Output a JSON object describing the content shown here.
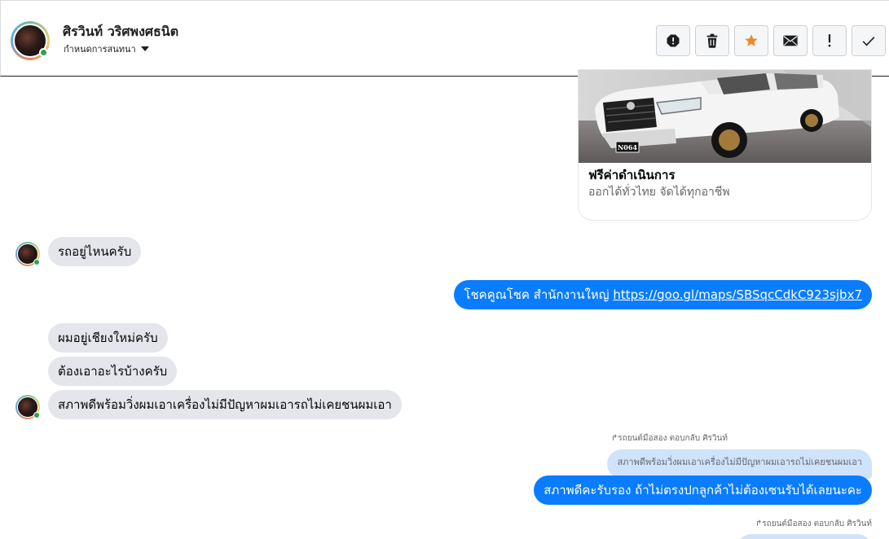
{
  "header": {
    "contact_name": "ศิรวินท์ วริศพงศธนิต",
    "assign_label": "กำหนดการสนทนา",
    "actions": [
      {
        "name": "spam-button",
        "icon": "exclamation-circle-icon"
      },
      {
        "name": "delete-button",
        "icon": "trash-icon"
      },
      {
        "name": "star-button",
        "icon": "star-icon",
        "color": "#f0892b"
      },
      {
        "name": "mark-unread-button",
        "icon": "envelope-icon"
      },
      {
        "name": "important-button",
        "icon": "exclamation-icon"
      },
      {
        "name": "mark-done-button",
        "icon": "checkmark-icon"
      }
    ]
  },
  "card": {
    "plate": "N064",
    "title": "ฟรีค่าดำเนินการ",
    "subtitle": "ออกได้ทั่วไทย จัดได้ทุกอาชีพ"
  },
  "messages": {
    "m1": "รถอยู่ไหนครับ",
    "m2_text": "โชคคูณโชค สำนักงานใหญ่ ",
    "m2_link": "https://goo.gl/maps/SBSqcCdkC923sjbx7",
    "m3": "ผมอยู่เชียงใหม่ครับ",
    "m4": "ต้องเอาอะไรบ้างครับ",
    "m5": "สภาพดีพร้อมวิ่งผมเอาเครื่องไม่มีปัญหาผมเอารถไม่เคยชนผมเอา",
    "reply1_meta": "รถยนต์มือสอง ตอบกลับ ศิรวินท์",
    "reply1_quote": "สภาพดีพร้อมวิ่งผมเอาเครื่องไม่มีปัญหาผมเอารถไม่เคยชนผมเอา",
    "m6": "สภาพดีคะรับรอง ถ้าไม่ตรงปกลูกค้าไม่ต้องเซนรับได้เลยนะคะ",
    "reply2_meta": "รถยนต์มือสอง ตอบกลับ ศิรวินท์"
  },
  "colors": {
    "outgoing_bubble": "#0a7cff",
    "incoming_bubble": "#e4e6eb",
    "quoted_bubble": "#cfe3fc",
    "star": "#f0892b"
  }
}
